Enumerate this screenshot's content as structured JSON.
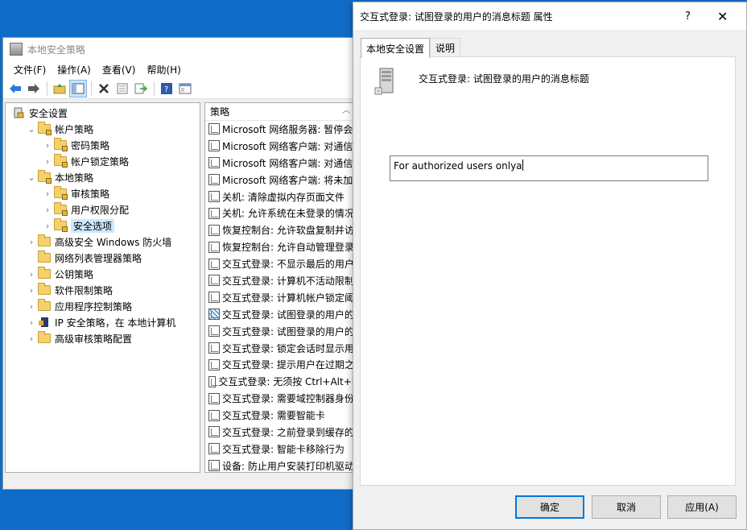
{
  "main_window": {
    "title": "本地安全策略",
    "menu": [
      "文件(F)",
      "操作(A)",
      "查看(V)",
      "帮助(H)"
    ],
    "toolbar_icons": [
      "back-icon",
      "forward-icon",
      "up-folder-icon",
      "show-hide-tree-icon",
      "delete-icon",
      "properties-icon",
      "export-icon",
      "help-icon",
      "console-icon"
    ]
  },
  "tree": [
    {
      "label": "安全设置",
      "level": 0,
      "chevron": "",
      "icon": "security-settings-icon"
    },
    {
      "label": "帐户策略",
      "level": 1,
      "chevron": "expanded",
      "icon": "folder-lock-icon"
    },
    {
      "label": "密码策略",
      "level": 2,
      "chevron": "collapsed",
      "icon": "folder-lock-icon"
    },
    {
      "label": "帐户锁定策略",
      "level": 2,
      "chevron": "collapsed",
      "icon": "folder-lock-icon"
    },
    {
      "label": "本地策略",
      "level": 1,
      "chevron": "expanded",
      "icon": "folder-lock-icon"
    },
    {
      "label": "审核策略",
      "level": 2,
      "chevron": "collapsed",
      "icon": "folder-lock-icon"
    },
    {
      "label": "用户权限分配",
      "level": 2,
      "chevron": "collapsed",
      "icon": "folder-lock-icon"
    },
    {
      "label": "安全选项",
      "level": 2,
      "chevron": "collapsed",
      "icon": "folder-lock-icon",
      "selected": true
    },
    {
      "label": "高级安全 Windows 防火墙",
      "level": 1,
      "chevron": "collapsed",
      "icon": "folder-icon"
    },
    {
      "label": "网络列表管理器策略",
      "level": 1,
      "chevron": "",
      "icon": "folder-icon"
    },
    {
      "label": "公钥策略",
      "level": 1,
      "chevron": "collapsed-blue",
      "icon": "folder-icon"
    },
    {
      "label": "软件限制策略",
      "level": 1,
      "chevron": "collapsed",
      "icon": "folder-icon"
    },
    {
      "label": "应用程序控制策略",
      "level": 1,
      "chevron": "collapsed",
      "icon": "folder-icon"
    },
    {
      "label": "IP 安全策略，在 本地计算机",
      "level": 1,
      "chevron": "collapsed",
      "icon": "ip-security-icon"
    },
    {
      "label": "高级审核策略配置",
      "level": 1,
      "chevron": "collapsed",
      "icon": "folder-icon"
    }
  ],
  "list": {
    "header": "策略",
    "rows": [
      "Microsoft 网络服务器: 暂停会",
      "Microsoft 网络客户端: 对通信",
      "Microsoft 网络客户端: 对通信",
      "Microsoft 网络客户端: 将未加",
      "关机: 清除虚拟内存页面文件",
      "关机: 允许系统在未登录的情况",
      "恢复控制台: 允许软盘复制并访",
      "恢复控制台: 允许自动管理登录",
      "交互式登录: 不显示最后的用户",
      "交互式登录: 计算机不活动限制",
      "交互式登录: 计算机帐户锁定阈",
      "交互式登录: 试图登录的用户的",
      "交互式登录: 试图登录的用户的",
      "交互式登录: 锁定会话时显示用",
      "交互式登录: 提示用户在过期之",
      "交互式登录: 无须按 Ctrl+Alt+D",
      "交互式登录: 需要域控制器身份",
      "交互式登录: 需要智能卡",
      "交互式登录: 之前登录到缓存的",
      "交互式登录: 智能卡移除行为",
      "设备: 防止用户安装打印机驱动"
    ],
    "selected_index": 11
  },
  "dialog": {
    "title": "交互式登录: 试图登录的用户的消息标题 属性",
    "help_glyph": "?",
    "close_glyph": "✕",
    "tabs": [
      "本地安全设置",
      "说明"
    ],
    "policy_name": "交互式登录: 试图登录的用户的消息标题",
    "input_value": "For authorized users onlya",
    "buttons": {
      "ok": "确定",
      "cancel": "取消",
      "apply": "应用(A)"
    }
  }
}
